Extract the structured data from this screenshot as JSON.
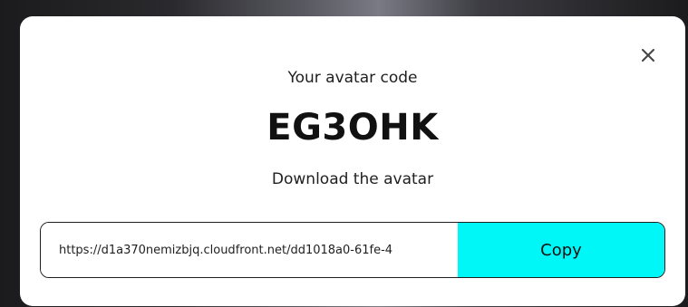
{
  "modal": {
    "heading": "Your avatar code",
    "code": "EG3OHK",
    "subheading": "Download the avatar",
    "url_value": "https://d1a370nemizbjq.cloudfront.net/dd1018a0-61fe-4",
    "copy_label": "Copy",
    "close_icon": "close-icon"
  },
  "colors": {
    "copy_button_bg": "#00f7f7",
    "modal_bg": "#ffffff",
    "text": "#111111"
  }
}
